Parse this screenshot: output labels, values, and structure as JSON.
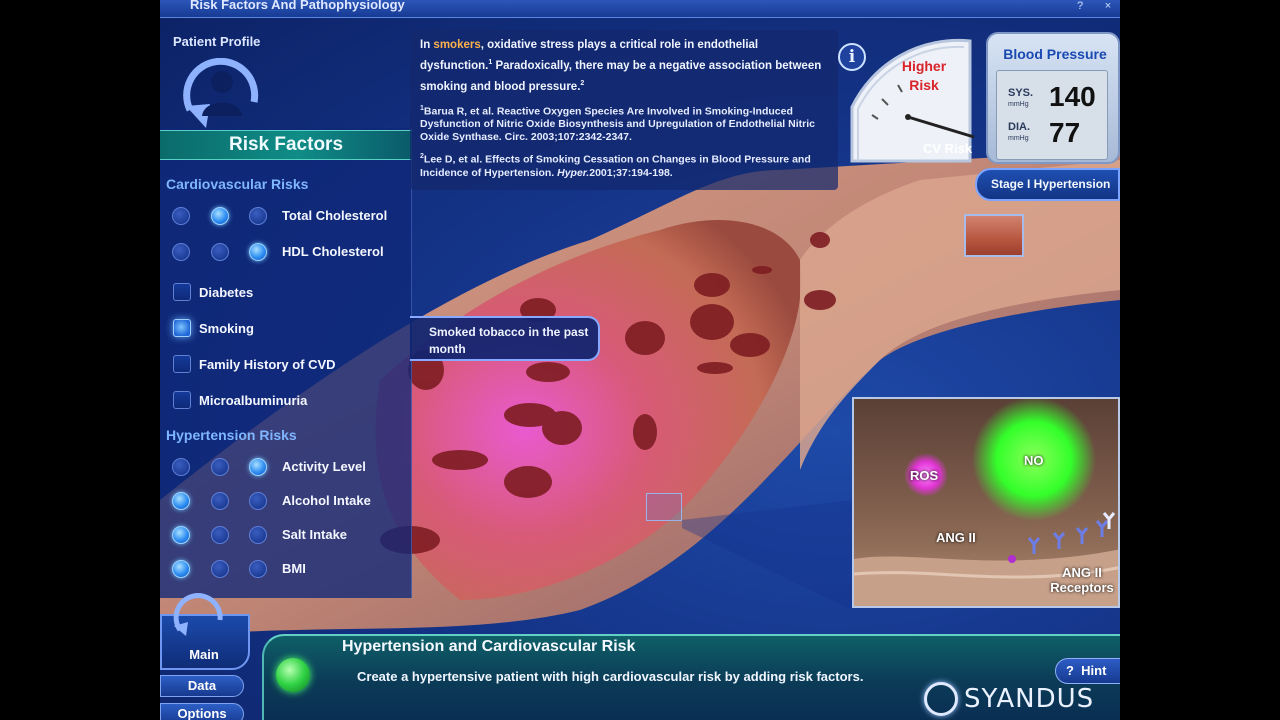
{
  "window": {
    "title": "Risk Factors And Pathophysiology",
    "help": "?",
    "close": "×"
  },
  "patient_profile": {
    "label": "Patient Profile"
  },
  "risk_factors": {
    "header": "Risk Factors",
    "cardio_title": "Cardiovascular Risks",
    "cardio_radios": [
      {
        "label": "Total Cholesterol",
        "selected_index": 1
      },
      {
        "label": "HDL Cholesterol",
        "selected_index": 2
      }
    ],
    "checkboxes": [
      {
        "label": "Diabetes",
        "checked": false
      },
      {
        "label": "Smoking",
        "checked": true
      },
      {
        "label": "Family History of CVD",
        "checked": false
      },
      {
        "label": "Microalbuminuria",
        "checked": false
      }
    ],
    "hyper_title": "Hypertension Risks",
    "hyper_radios": [
      {
        "label": "Activity Level",
        "selected_index": 2
      },
      {
        "label": "Alcohol Intake",
        "selected_index": 0
      },
      {
        "label": "Salt Intake",
        "selected_index": 0
      },
      {
        "label": "BMI",
        "selected_index": 0
      }
    ]
  },
  "info": {
    "p1_pre": "In ",
    "p1_hl": "smokers",
    "p1_post": ", oxidative stress plays a critical role in endothelial dysfunction.",
    "p1_sup": "1",
    "p2": " Paradoxically, there may be a negative association between smoking and blood pressure.",
    "p2_sup": "2",
    "ref1_sup": "1",
    "ref1": "Barua R, et al. Reactive Oxygen Species Are Involved in Smoking-Induced Dysfunction of Nitric Oxide Biosynthesis and Upregulation of Endothelial Nitric Oxide Synthase. Circ. 2003;107:2342-2347.",
    "ref2_sup": "2",
    "ref2_pre": "Lee D, et al. Effects of Smoking Cessation on Changes in Blood Pressure and Incidence of Hypertension. ",
    "ref2_journal": "Hyper.",
    "ref2_post": "2001;37:194-198.",
    "icon_glyph": "i"
  },
  "cv_risk": {
    "gauge_text_1": "Higher",
    "gauge_text_2": "Risk",
    "label": "CV Risk",
    "needle_level": 0.2
  },
  "blood_pressure": {
    "title": "Blood Pressure",
    "sys_label": "SYS.",
    "dia_label": "DIA.",
    "unit": "mmHg",
    "sys": "140",
    "dia": "77"
  },
  "stage_label": "Stage I Hypertension",
  "tooltip": "Smoked tobacco in the past month",
  "inset": {
    "ros": "ROS",
    "no": "NO",
    "ang": "ANG II",
    "receptors": "ANG II Receptors"
  },
  "bottom": {
    "lesson_title": "Hypertension and Cardiovascular Risk",
    "lesson_desc": "Create a hypertensive patient with high cardiovascular risk by adding risk factors.",
    "nav": [
      "Main",
      "Data",
      "Options"
    ],
    "hint": "Hint",
    "brand": "SYANDUS"
  },
  "colors": {
    "accent": "#ffb24a",
    "panel": "#0f2878",
    "teal": "#0f8c86",
    "green": "#2fd244"
  }
}
